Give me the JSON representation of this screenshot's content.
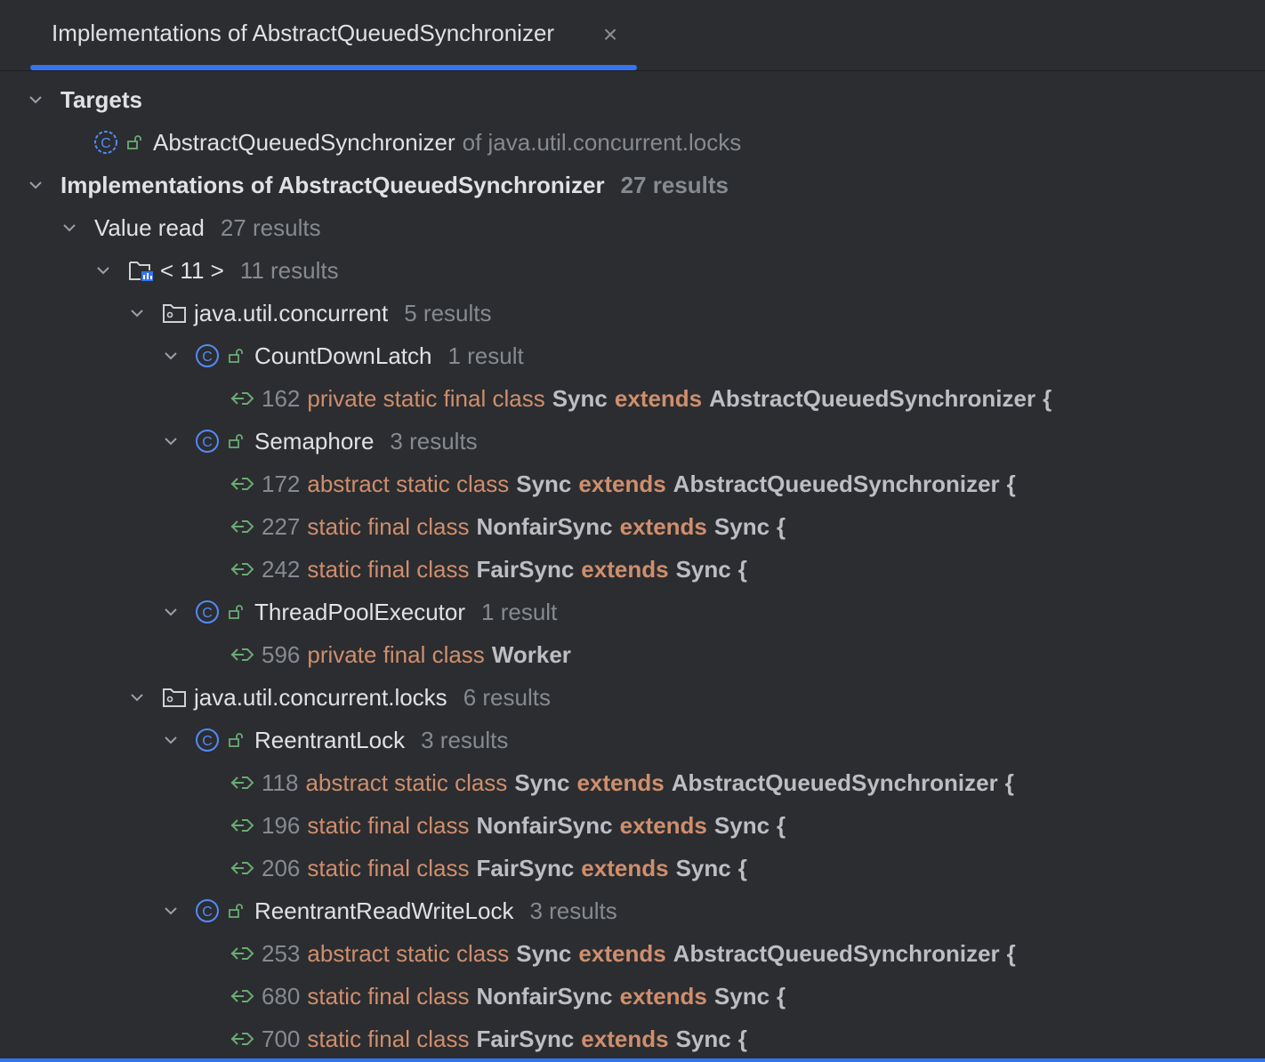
{
  "tab": {
    "title": "Implementations of AbstractQueuedSynchronizer",
    "close_icon": "close-icon"
  },
  "targets": {
    "label": "Targets",
    "item_name": "AbstractQueuedSynchronizer",
    "item_package": "of java.util.concurrent.locks"
  },
  "results_root": {
    "label": "Implementations of AbstractQueuedSynchronizer",
    "count": "27 results"
  },
  "value_read": {
    "label": "Value read",
    "count": "27 results"
  },
  "module": {
    "label": "< 11 >",
    "count": "11 results"
  },
  "packages": [
    {
      "label": "java.util.concurrent",
      "count": "5 results",
      "classes": [
        {
          "name": "CountDownLatch",
          "count": "1 result",
          "lines": [
            {
              "num": "162",
              "kw1": "private static final class",
              "n1": "Sync",
              "kw2": "extends",
              "n2": "AbstractQueuedSynchronizer",
              "tail": "{"
            }
          ]
        },
        {
          "name": "Semaphore",
          "count": "3 results",
          "lines": [
            {
              "num": "172",
              "kw1": "abstract static class",
              "n1": "Sync",
              "kw2": "extends",
              "n2": "AbstractQueuedSynchronizer",
              "tail": "{"
            },
            {
              "num": "227",
              "kw1": "static final class",
              "n1": "NonfairSync",
              "kw2": "extends",
              "n2": "Sync",
              "tail": "{"
            },
            {
              "num": "242",
              "kw1": "static final class",
              "n1": "FairSync",
              "kw2": "extends",
              "n2": "Sync",
              "tail": "{"
            }
          ]
        },
        {
          "name": "ThreadPoolExecutor",
          "count": "1 result",
          "lines": [
            {
              "num": "596",
              "kw1": "private final class",
              "n1": "Worker",
              "kw2": "",
              "n2": "",
              "tail": ""
            }
          ]
        }
      ]
    },
    {
      "label": "java.util.concurrent.locks",
      "count": "6 results",
      "classes": [
        {
          "name": "ReentrantLock",
          "count": "3 results",
          "lines": [
            {
              "num": "118",
              "kw1": "abstract static class",
              "n1": "Sync",
              "kw2": "extends",
              "n2": "AbstractQueuedSynchronizer",
              "tail": "{"
            },
            {
              "num": "196",
              "kw1": "static final class",
              "n1": "NonfairSync",
              "kw2": "extends",
              "n2": "Sync",
              "tail": "{"
            },
            {
              "num": "206",
              "kw1": "static final class",
              "n1": "FairSync",
              "kw2": "extends",
              "n2": "Sync",
              "tail": "{"
            }
          ]
        },
        {
          "name": "ReentrantReadWriteLock",
          "count": "3 results",
          "lines": [
            {
              "num": "253",
              "kw1": "abstract static class",
              "n1": "Sync",
              "kw2": "extends",
              "n2": "AbstractQueuedSynchronizer",
              "tail": "{"
            },
            {
              "num": "680",
              "kw1": "static final class",
              "n1": "NonfairSync",
              "kw2": "extends",
              "n2": "Sync",
              "tail": "{"
            },
            {
              "num": "700",
              "kw1": "static final class",
              "n1": "FairSync",
              "kw2": "extends",
              "n2": "Sync",
              "tail": "{"
            }
          ]
        }
      ]
    }
  ],
  "colors": {
    "background": "#2b2d30",
    "accent": "#3574f0",
    "keyword": "#cf8e6d",
    "dim": "#868a91",
    "usage_arrow": "#6aab73"
  }
}
